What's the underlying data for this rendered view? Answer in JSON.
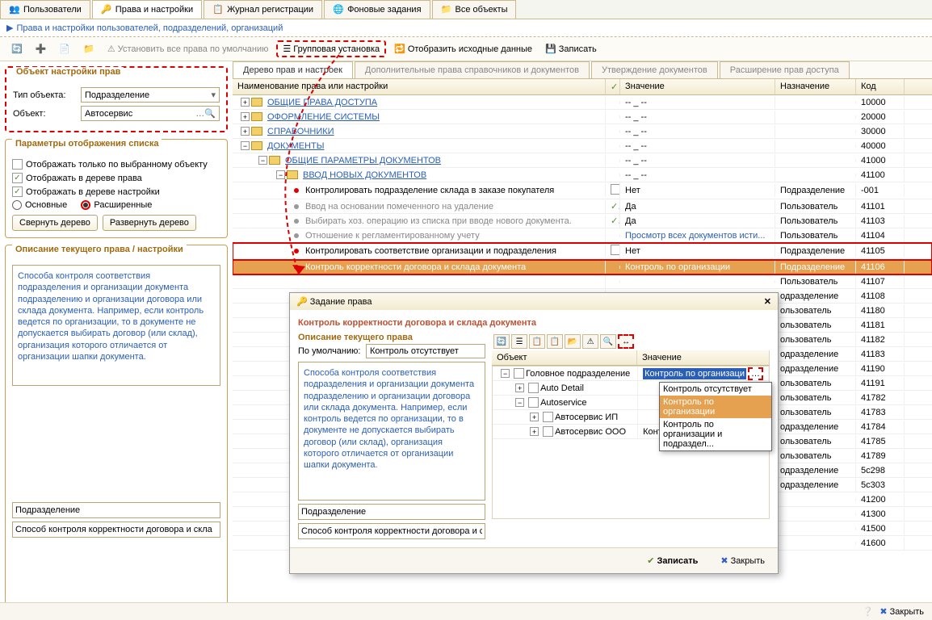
{
  "tabs": {
    "users": "Пользователи",
    "rights": "Права и настройки",
    "log": "Журнал регистрации",
    "bg": "Фоновые задания",
    "all": "Все объекты"
  },
  "breadcrumb": "Права и настройки пользователей, подразделений, организаций",
  "toolbar": {
    "set_defaults": "Установить все права по умолчанию",
    "group_install": "Групповая установка",
    "show_source": "Отобразить исходные данные",
    "save": "Записать"
  },
  "left": {
    "box1_title": "Объект настройки прав",
    "type_label": "Тип объекта:",
    "type_value": "Подразделение",
    "object_label": "Объект:",
    "object_value": "Автосервис",
    "box2_title": "Параметры отображения списка",
    "chk1": "Отображать только по выбранному объекту",
    "chk2": "Отображать в дереве права",
    "chk3": "Отображать в дереве настройки",
    "radio1": "Основные",
    "radio2": "Расширенные",
    "collapse": "Свернуть дерево",
    "expand": "Развернуть дерево",
    "box3_title": "Описание текущего права / настройки",
    "desc": "Способа контроля соответствия подразделения и организации документа подразделению и организации договора или склада документа. Например, если контроль ведется по организации, то в документе не допускается выбирать договор (или склад), организация которого отличается от организации шапки документа.",
    "inp1": "Подразделение",
    "inp2": "Способ контроля корректности договора и скла"
  },
  "inner_tabs": {
    "t1": "Дерево прав и настроек",
    "t2": "Дополнительные права справочников и документов",
    "t3": "Утверждение документов",
    "t4": "Расширение прав доступа"
  },
  "grid_hdr": {
    "name": "Наименование права или настройки",
    "val": "Значение",
    "naz": "Назначение",
    "code": "Код"
  },
  "rows": [
    {
      "name": "ОБЩИЕ ПРАВА ДОСТУПА",
      "type": "folder",
      "exp": "+",
      "lvl": 0,
      "val": "-- _ --",
      "naz": "",
      "code": "10000"
    },
    {
      "name": "ОФОРМЛЕНИЕ СИСТЕМЫ",
      "type": "folder",
      "exp": "+",
      "lvl": 0,
      "val": "-- _ --",
      "naz": "",
      "code": "20000"
    },
    {
      "name": "СПРАВОЧНИКИ",
      "type": "folder",
      "exp": "+",
      "lvl": 0,
      "val": "-- _ --",
      "naz": "",
      "code": "30000"
    },
    {
      "name": "ДОКУМЕНТЫ",
      "type": "folder",
      "exp": "−",
      "lvl": 0,
      "val": "-- _ --",
      "naz": "",
      "code": "40000"
    },
    {
      "name": "ОБЩИЕ ПАРАМЕТРЫ ДОКУМЕНТОВ",
      "type": "folder",
      "exp": "−",
      "lvl": 1,
      "val": "-- _ --",
      "naz": "",
      "code": "41000"
    },
    {
      "name": "ВВОД НОВЫХ ДОКУМЕНТОВ",
      "type": "folder",
      "exp": "−",
      "lvl": 2,
      "val": "-- _ --",
      "naz": "",
      "code": "41100"
    },
    {
      "name": "Контролировать подразделение склада в заказе покупателя",
      "type": "item",
      "dot": "red",
      "lvl": 3,
      "chk": false,
      "val": "Нет",
      "naz": "Подразделение",
      "code": "-001"
    },
    {
      "name": "Ввод на основании помеченного на удаление",
      "type": "item",
      "dot": "gray",
      "lvl": 3,
      "chk": true,
      "val": "Да",
      "naz": "Пользователь",
      "code": "41101"
    },
    {
      "name": "Выбирать хоз. операцию из списка при вводе нового документа.",
      "type": "item",
      "dot": "gray",
      "lvl": 3,
      "chk": true,
      "val": "Да",
      "naz": "Пользователь",
      "code": "41103"
    },
    {
      "name": "Отношение к регламентированному учету",
      "type": "item",
      "dot": "gray",
      "lvl": 3,
      "val": "Просмотр всех документов исти...",
      "valcolor": "#2b5fb5",
      "naz": "Пользователь",
      "code": "41104"
    },
    {
      "name": "Контролировать соответствие организации и подразделения",
      "type": "item",
      "dot": "red",
      "lvl": 3,
      "chk": false,
      "val": "Нет",
      "naz": "Подразделение",
      "code": "41105",
      "hl": true
    },
    {
      "name": "Контроль корректности договора и склада документа",
      "type": "item",
      "dot": "red",
      "lvl": 3,
      "val": "Контроль по организации",
      "naz": "Подразделение",
      "code": "41106",
      "hl2": true
    },
    {
      "name": "",
      "type": "empty",
      "code": "41107",
      "naz": "Пользователь"
    },
    {
      "name": "",
      "type": "empty",
      "code": "41108",
      "naz": "одразделение"
    },
    {
      "name": "",
      "type": "empty",
      "code": "41180",
      "naz": "ользователь"
    },
    {
      "name": "",
      "type": "empty",
      "code": "41181",
      "naz": "ользователь"
    },
    {
      "name": "",
      "type": "empty",
      "code": "41182",
      "naz": "ользователь"
    },
    {
      "name": "",
      "type": "empty",
      "code": "41183",
      "naz": "одразделение"
    },
    {
      "name": "",
      "type": "empty",
      "code": "41190",
      "naz": "одразделение"
    },
    {
      "name": "",
      "type": "empty",
      "code": "41191",
      "naz": "ользователь"
    },
    {
      "name": "",
      "type": "empty",
      "code": "41782",
      "naz": "ользователь"
    },
    {
      "name": "",
      "type": "empty",
      "code": "41783",
      "naz": "ользователь"
    },
    {
      "name": "",
      "type": "empty",
      "code": "41784",
      "naz": "одразделение"
    },
    {
      "name": "",
      "type": "empty",
      "code": "41785",
      "naz": "ользователь"
    },
    {
      "name": "",
      "type": "empty",
      "code": "41789",
      "naz": "ользователь"
    },
    {
      "name": "",
      "type": "empty",
      "code": "5c298",
      "naz": "одразделение"
    },
    {
      "name": "",
      "type": "empty",
      "code": "5c303",
      "naz": "одразделение"
    },
    {
      "name": "",
      "type": "empty",
      "code": "41200",
      "naz": ""
    },
    {
      "name": "",
      "type": "empty",
      "code": "41300",
      "naz": ""
    },
    {
      "name": "",
      "type": "empty",
      "code": "41500",
      "naz": ""
    },
    {
      "name": "",
      "type": "empty",
      "code": "41600",
      "naz": ""
    }
  ],
  "popup": {
    "title": "Задание права",
    "heading": "Контроль корректности договора и склада документа",
    "sub": "Описание текущего права",
    "default_label": "По умолчанию:",
    "default_value": "Контроль отсутствует",
    "desc": "Способа контроля соответствия подразделения и организации документа подразделению и организации договора или склада документа. Например, если контроль ведется по организации, то в документе не допускается выбирать договор (или склад), организация которого отличается от организации шапки документа.",
    "tree_hdr_obj": "Объект",
    "tree_hdr_val": "Значение",
    "tree": [
      {
        "name": "Головное подразделение",
        "val": "Контроль по организаци",
        "lvl": 0,
        "exp": "−",
        "sel": true
      },
      {
        "name": "Auto Detail",
        "val": "",
        "lvl": 1,
        "exp": "+"
      },
      {
        "name": "Autoservice",
        "val": "",
        "lvl": 1,
        "exp": "−"
      },
      {
        "name": "Автосервис ИП",
        "val": "",
        "lvl": 2,
        "exp": "+"
      },
      {
        "name": "Автосервис ООО",
        "val": "Контроль по организации",
        "lvl": 2,
        "exp": "+"
      }
    ],
    "footer_inp1": "Подразделение",
    "footer_inp2": "Способ контроля корректности договора и ск...",
    "save": "Записать",
    "close": "Закрыть"
  },
  "dropdown": {
    "items": [
      {
        "t": "Контроль отсутствует",
        "sel": false
      },
      {
        "t": "Контроль по организации",
        "sel": true
      },
      {
        "t": "Контроль по организации и подраздел...",
        "sel": false
      }
    ]
  },
  "footer": {
    "close": "Закрыть"
  }
}
